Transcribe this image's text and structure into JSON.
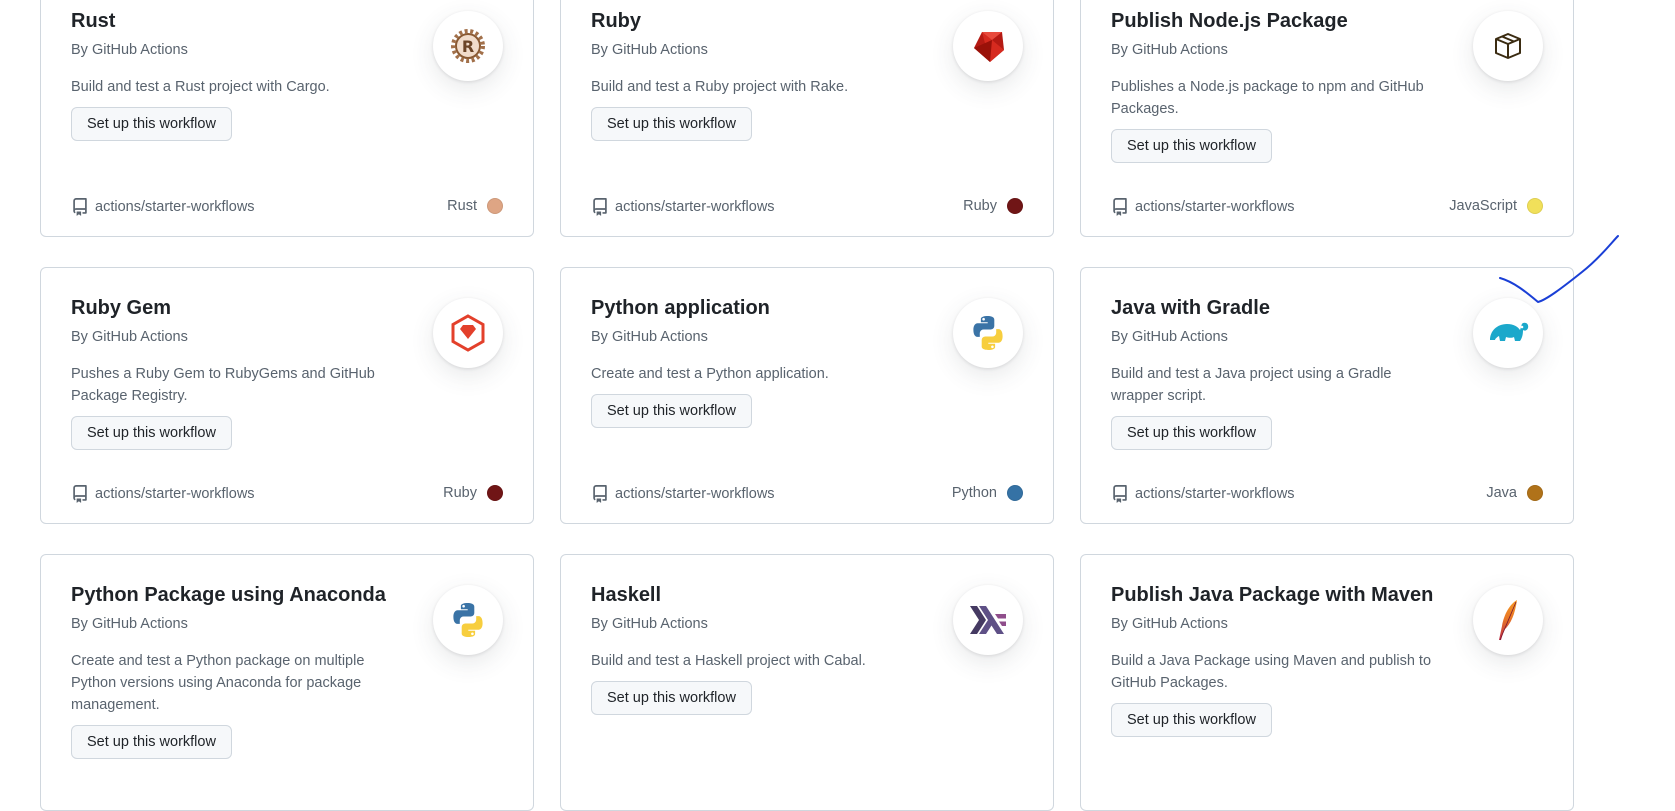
{
  "cards": [
    {
      "title": "Rust",
      "byline": "By GitHub Actions",
      "description": "Build and test a Rust project with Cargo.",
      "button": "Set up this workflow",
      "repo": "actions/starter-workflows",
      "language": "Rust",
      "language_color": "#dea584",
      "icon": "rust-logo-icon"
    },
    {
      "title": "Ruby",
      "byline": "By GitHub Actions",
      "description": "Build and test a Ruby project with Rake.",
      "button": "Set up this workflow",
      "repo": "actions/starter-workflows",
      "language": "Ruby",
      "language_color": "#701516",
      "icon": "ruby-logo-icon"
    },
    {
      "title": "Publish Node.js Package",
      "byline": "By GitHub Actions",
      "description": "Publishes a Node.js package to npm and GitHub Packages.",
      "button": "Set up this workflow",
      "repo": "actions/starter-workflows",
      "language": "JavaScript",
      "language_color": "#f1e05a",
      "icon": "package-icon"
    },
    {
      "title": "Ruby Gem",
      "byline": "By GitHub Actions",
      "description": "Pushes a Ruby Gem to RubyGems and GitHub Package Registry.",
      "button": "Set up this workflow",
      "repo": "actions/starter-workflows",
      "language": "Ruby",
      "language_color": "#701516",
      "icon": "ruby-gem-logo-icon"
    },
    {
      "title": "Python application",
      "byline": "By GitHub Actions",
      "description": "Create and test a Python application.",
      "button": "Set up this workflow",
      "repo": "actions/starter-workflows",
      "language": "Python",
      "language_color": "#3572A5",
      "icon": "python-logo-icon"
    },
    {
      "title": "Java with Gradle",
      "byline": "By GitHub Actions",
      "description": "Build and test a Java project using a Gradle wrapper script.",
      "button": "Set up this workflow",
      "repo": "actions/starter-workflows",
      "language": "Java",
      "language_color": "#b07219",
      "icon": "gradle-logo-icon"
    },
    {
      "title": "Python Package using Anaconda",
      "byline": "By GitHub Actions",
      "description": "Create and test a Python package on multiple Python versions using Anaconda for package management.",
      "button": "Set up this workflow",
      "repo": "",
      "language": "",
      "language_color": "",
      "icon": "python-logo-icon"
    },
    {
      "title": "Haskell",
      "byline": "By GitHub Actions",
      "description": "Build and test a Haskell project with Cabal.",
      "button": "Set up this workflow",
      "repo": "",
      "language": "",
      "language_color": "",
      "icon": "haskell-logo-icon"
    },
    {
      "title": "Publish Java Package with Maven",
      "byline": "By GitHub Actions",
      "description": "Build a Java Package using Maven and publish to GitHub Packages.",
      "button": "Set up this workflow",
      "repo": "",
      "language": "",
      "language_color": "",
      "icon": "maven-feather-logo-icon"
    }
  ],
  "annotation": {
    "icon": "checkmark-annotation-icon",
    "color": "#1a3fd6"
  }
}
